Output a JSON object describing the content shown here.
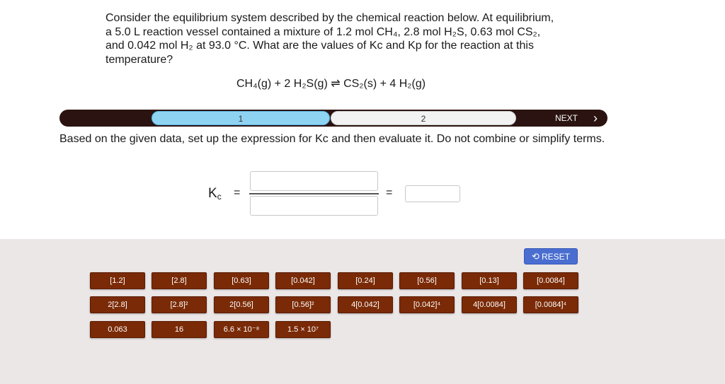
{
  "question": {
    "text": "Consider the equilibrium system described by the chemical reaction below. At equilibrium, a 5.0 L reaction vessel contained a mixture of 1.2 mol CH₄, 2.8 mol H₂S, 0.63 mol CS₂, and 0.042 mol H₂ at 93.0 °C. What are the values of Kc and Kp for the reaction at this temperature?",
    "reaction": "CH₄(g) + 2 H₂S(g) ⇌ CS₂(s) + 4 H₂(g)"
  },
  "progress": {
    "step1": "1",
    "step2": "2",
    "next_label": "NEXT",
    "next_icon": "›"
  },
  "instruction": "Based on the given data, set up the expression for Kc and then evaluate it. Do not combine or simplify terms.",
  "expression": {
    "k_symbol": "K",
    "k_subscript": "c",
    "equals": "="
  },
  "tray": {
    "reset_label": "RESET",
    "reset_icon": "⟲",
    "row1": [
      "[1.2]",
      "[2.8]",
      "[0.63]",
      "[0.042]",
      "[0.24]",
      "[0.56]",
      "[0.13]",
      "[0.0084]"
    ],
    "row2": [
      "2[2.8]",
      "[2.8]²",
      "2[0.56]",
      "[0.56]²",
      "4[0.042]",
      "[0.042]⁴",
      "4[0.0084]",
      "[0.0084]⁴"
    ],
    "row3": [
      "0.063",
      "16",
      "6.6 × 10⁻⁸",
      "1.5 × 10⁷"
    ]
  }
}
